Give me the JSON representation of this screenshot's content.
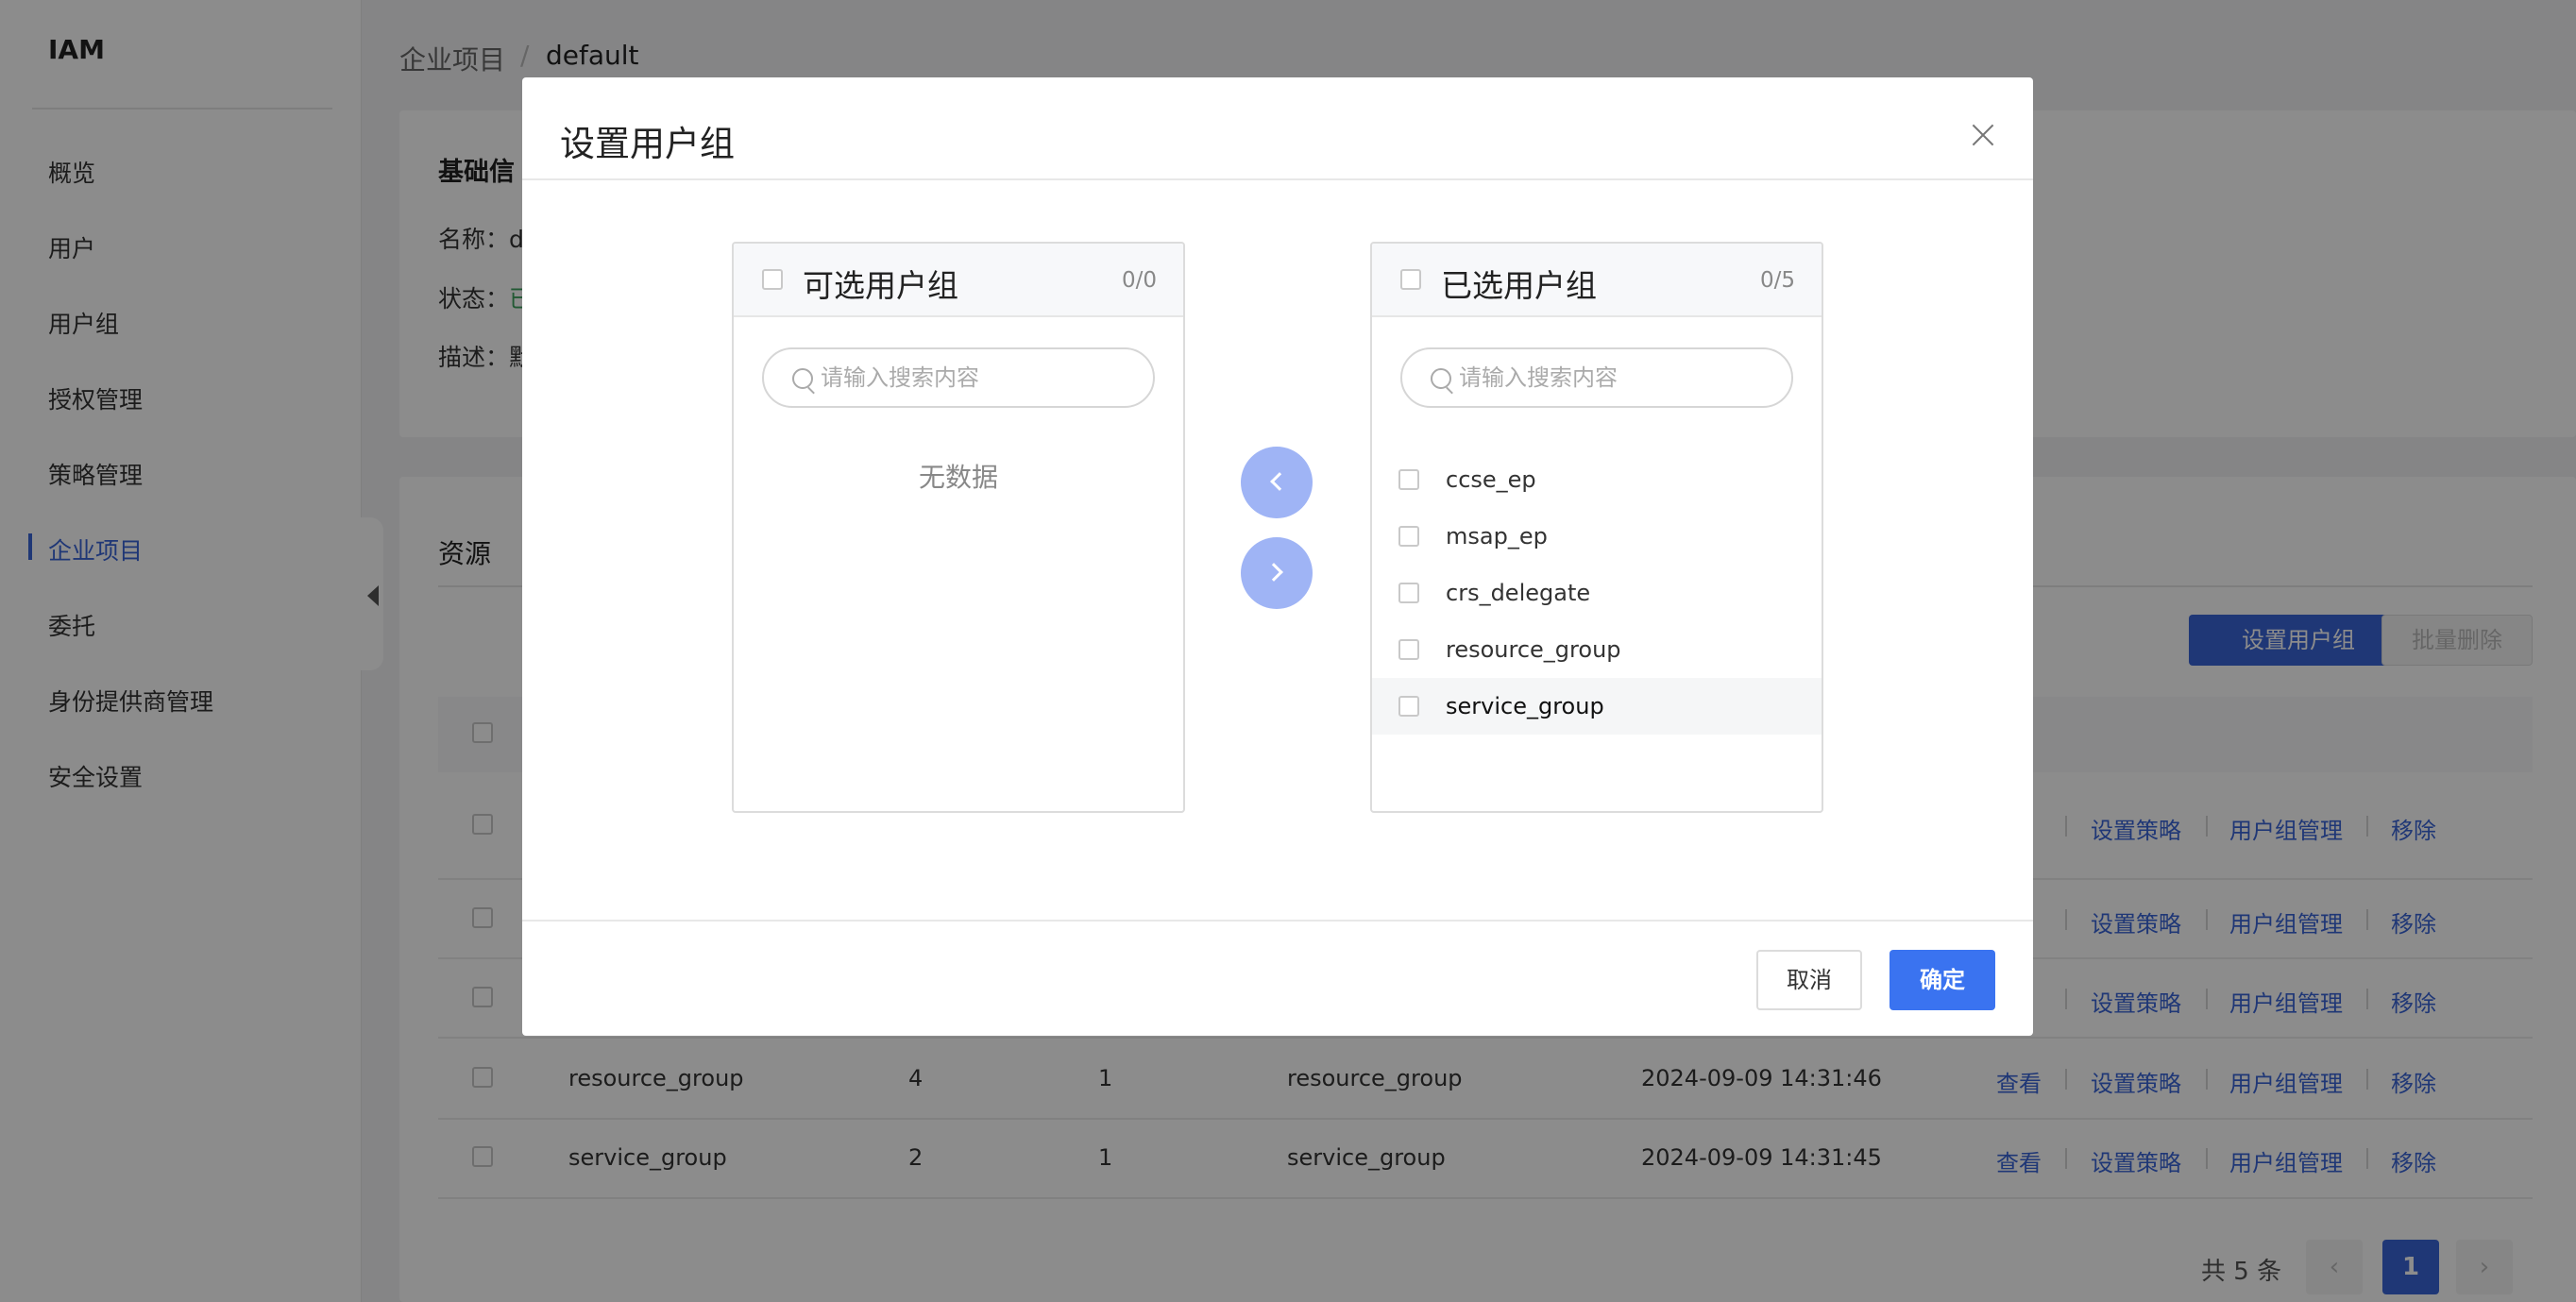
{
  "app": {
    "brand": "IAM"
  },
  "sidebar": {
    "items": [
      {
        "label": "概览"
      },
      {
        "label": "用户"
      },
      {
        "label": "用户组"
      },
      {
        "label": "授权管理"
      },
      {
        "label": "策略管理"
      },
      {
        "label": "企业项目",
        "active": true
      },
      {
        "label": "委托"
      },
      {
        "label": "身份提供商管理"
      },
      {
        "label": "安全设置"
      }
    ]
  },
  "breadcrumb": {
    "parent": "企业项目",
    "separator": "/",
    "current": "default"
  },
  "info": {
    "title": "基础信",
    "name_label": "名称：",
    "name_value": "de",
    "status_label": "状态：",
    "status_value": "已",
    "desc_label": "描述：",
    "desc_value": "默"
  },
  "resources": {
    "title": "资源",
    "buttons": {
      "set_group": "设置用户组",
      "batch_delete": "批量删除"
    },
    "table": {
      "action_header": "作",
      "rows": [
        {
          "name": "",
          "col2": "",
          "col3": "",
          "desc": "",
          "time": "",
          "view": "看"
        },
        {
          "name": "",
          "col2": "",
          "col3": "",
          "desc": "",
          "time": "",
          "view": "看"
        },
        {
          "name": "",
          "col2": "",
          "col3": "",
          "desc": "",
          "time": "",
          "view": "看"
        },
        {
          "name": "resource_group",
          "col2": "4",
          "col3": "1",
          "desc": "resource_group",
          "time": "2024-09-09 14:31:46",
          "view": "查看"
        },
        {
          "name": "service_group",
          "col2": "2",
          "col3": "1",
          "desc": "service_group",
          "time": "2024-09-09 14:31:45",
          "view": "查看"
        }
      ],
      "actions": {
        "set_policy": "设置策略",
        "group_manage": "用户组管理",
        "remove": "移除"
      }
    },
    "pagination": {
      "total": "共 5 条",
      "current_page": "1"
    }
  },
  "modal": {
    "title": "设置用户组",
    "left_panel": {
      "title": "可选用户组",
      "count": "0/0",
      "search_placeholder": "请输入搜索内容",
      "empty_text": "无数据"
    },
    "right_panel": {
      "title": "已选用户组",
      "count": "0/5",
      "search_placeholder": "请输入搜索内容",
      "items": [
        "ccse_ep",
        "msap_ep",
        "crs_delegate",
        "resource_group",
        "service_group"
      ]
    },
    "footer": {
      "cancel": "取消",
      "confirm": "确定"
    }
  },
  "colors": {
    "primary": "#3a64d8",
    "confirm": "#3a73f0",
    "transfer_button": "#9fb4f5"
  }
}
